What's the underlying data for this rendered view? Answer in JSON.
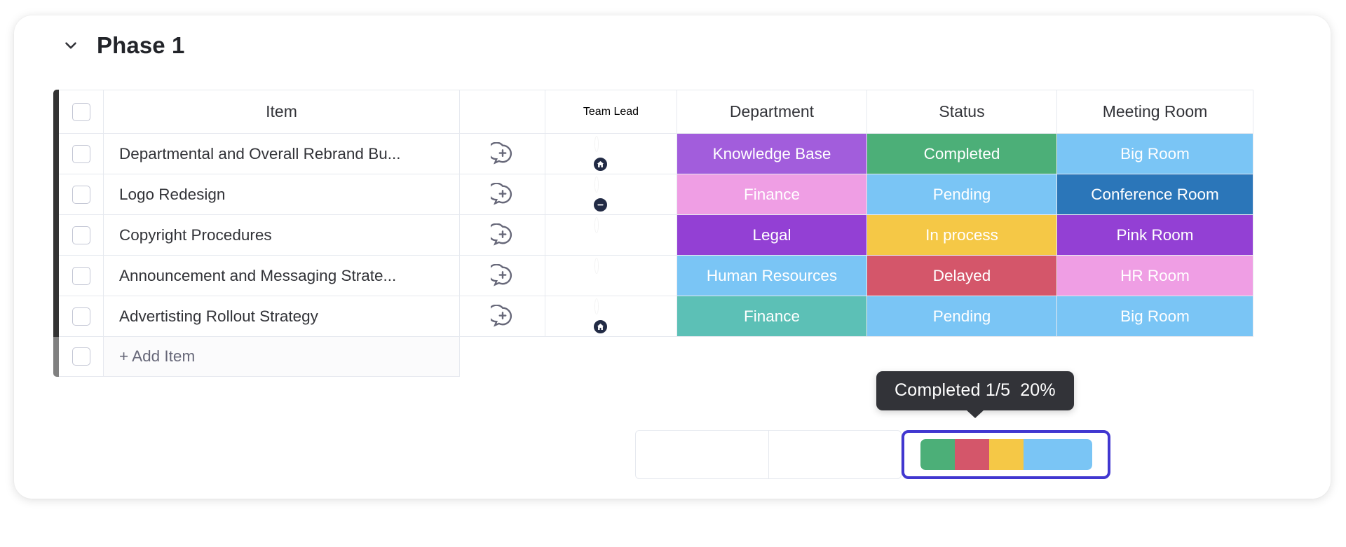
{
  "board": {
    "group_title": "Phase 1",
    "collapse_icon": "chevron-down-icon",
    "group_bar_color": "#333333",
    "group_bar_faded_color": "#808080"
  },
  "columns": [
    {
      "key": "item",
      "label": "Item"
    },
    {
      "key": "comment",
      "label": ""
    },
    {
      "key": "person",
      "label": "Team Lead"
    },
    {
      "key": "dept",
      "label": "Department"
    },
    {
      "key": "status",
      "label": "Status"
    },
    {
      "key": "room",
      "label": "Meeting Room"
    }
  ],
  "rows": [
    {
      "item": "Departmental and Overall Rebrand Bu...",
      "comment_icon": "add-comment-icon",
      "avatar_class": "av-a",
      "badge_icon": "home-icon",
      "dept": "Knowledge Base",
      "dept_color": "#a druggist",
      "department": "Knowledge Base",
      "department_color": "#a25ddc",
      "status": "Completed",
      "status_color": "#4caf78",
      "room": "Big Room",
      "room_color": "#7ac5f5"
    },
    {
      "item": "Logo Redesign",
      "comment_icon": "add-comment-icon",
      "avatar_class": "av-b",
      "badge_icon": "do-not-disturb-icon",
      "department": "Finance",
      "department_color": "#ef9ee4",
      "status": "Pending",
      "status_color": "#7ac5f5",
      "room": "Conference Room",
      "room_color": "#2b76b9"
    },
    {
      "item": "Copyright Procedures",
      "comment_icon": "add-comment-icon",
      "avatar_class": "av-c",
      "badge_icon": "",
      "department": "Legal",
      "department_color": "#9340d4",
      "status": "In process",
      "status_color": "#f5c846",
      "room": "Pink Room",
      "room_color": "#9340d4"
    },
    {
      "item": "Announcement and Messaging Strate...",
      "comment_icon": "add-comment-icon",
      "avatar_class": "av-d",
      "badge_icon": "",
      "department": "Human Resources",
      "department_color": "#7ac5f5",
      "status": "Delayed",
      "status_color": "#d4566a",
      "room": "HR Room",
      "room_color": "#ef9ee4"
    },
    {
      "item": "Advertisting Rollout Strategy",
      "comment_icon": "add-comment-icon",
      "avatar_class": "av-e",
      "badge_icon": "home-icon",
      "department": "Finance",
      "department_color": "#5cc0b6",
      "status": "Pending",
      "status_color": "#7ac5f5",
      "room": "Big Room",
      "room_color": "#7ac5f5"
    }
  ],
  "add_item": {
    "label": "+ Add Item"
  },
  "tooltip": {
    "status_label": "Completed",
    "fraction": "1/5",
    "percent": "20%"
  },
  "progress": {
    "selected_outline_color": "#4137d0",
    "segments": [
      {
        "label": "Completed",
        "color": "#4caf78",
        "width_pct": 20
      },
      {
        "label": "Delayed",
        "color": "#d4566a",
        "width_pct": 20
      },
      {
        "label": "In process",
        "color": "#f5c846",
        "width_pct": 20
      },
      {
        "label": "Pending",
        "color": "#7ac5f5",
        "width_pct": 40
      }
    ]
  }
}
